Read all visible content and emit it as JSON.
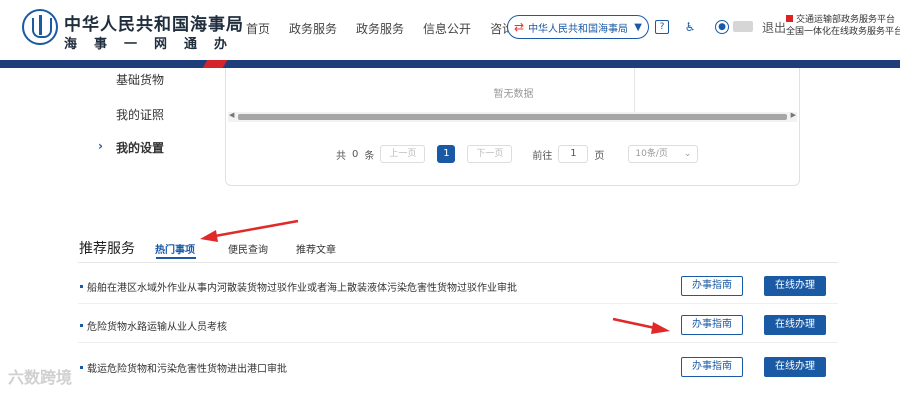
{
  "header": {
    "brand_title": "中华人民共和国海事局",
    "brand_subtitle": "海事一网通办",
    "nav": [
      "首页",
      "政务服务",
      "政务服务",
      "信息公开",
      "咨询投诉"
    ],
    "site_select": "中华人民共和国海事局",
    "logout": "退出",
    "platform_line1": "交通运输部政务服务平台",
    "platform_line2": "全国一体化在线政务服务平台"
  },
  "sidebar": {
    "items": [
      "基础货物",
      "我的证照",
      "我的设置"
    ],
    "active_index": 2
  },
  "table": {
    "empty_text": "暂无数据",
    "pager": {
      "total_prefix": "共",
      "total": "0",
      "total_suffix": "条",
      "prev": "上一页",
      "current": "1",
      "next": "下一页",
      "goto_prefix": "前往",
      "goto_value": "1",
      "goto_suffix": "页",
      "page_size": "10条/页"
    }
  },
  "recommend": {
    "title": "推荐服务",
    "tabs": [
      "热门事项",
      "便民查询",
      "推荐文章"
    ],
    "active_tab": 0,
    "rows": [
      {
        "text": "船舶在港区水域外作业从事内河散装货物过驳作业或者海上散装液体污染危害性货物过驳作业审批",
        "guide": "办事指南",
        "apply": "在线办理"
      },
      {
        "text": "危险货物水路运输从业人员考核",
        "guide": "办事指南",
        "apply": "在线办理"
      },
      {
        "text": "载运危险货物和污染危害性货物进出港口审批",
        "guide": "办事指南",
        "apply": "在线办理"
      }
    ]
  },
  "watermark": "六数跨境",
  "colors": {
    "primary": "#1a5aa5",
    "stripe": "#1e3d7a",
    "accent_red": "#d3252c",
    "arrow": "#e02a2a"
  }
}
